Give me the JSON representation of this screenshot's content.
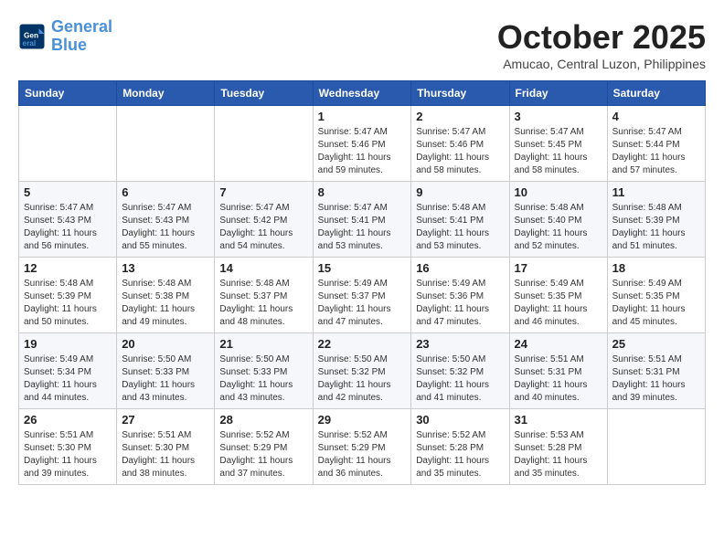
{
  "header": {
    "logo_line1": "General",
    "logo_line2": "Blue",
    "month": "October 2025",
    "location": "Amucao, Central Luzon, Philippines"
  },
  "weekdays": [
    "Sunday",
    "Monday",
    "Tuesday",
    "Wednesday",
    "Thursday",
    "Friday",
    "Saturday"
  ],
  "weeks": [
    [
      {
        "day": "",
        "sunrise": "",
        "sunset": "",
        "daylight": ""
      },
      {
        "day": "",
        "sunrise": "",
        "sunset": "",
        "daylight": ""
      },
      {
        "day": "",
        "sunrise": "",
        "sunset": "",
        "daylight": ""
      },
      {
        "day": "1",
        "sunrise": "Sunrise: 5:47 AM",
        "sunset": "Sunset: 5:46 PM",
        "daylight": "Daylight: 11 hours and 59 minutes."
      },
      {
        "day": "2",
        "sunrise": "Sunrise: 5:47 AM",
        "sunset": "Sunset: 5:46 PM",
        "daylight": "Daylight: 11 hours and 58 minutes."
      },
      {
        "day": "3",
        "sunrise": "Sunrise: 5:47 AM",
        "sunset": "Sunset: 5:45 PM",
        "daylight": "Daylight: 11 hours and 58 minutes."
      },
      {
        "day": "4",
        "sunrise": "Sunrise: 5:47 AM",
        "sunset": "Sunset: 5:44 PM",
        "daylight": "Daylight: 11 hours and 57 minutes."
      }
    ],
    [
      {
        "day": "5",
        "sunrise": "Sunrise: 5:47 AM",
        "sunset": "Sunset: 5:43 PM",
        "daylight": "Daylight: 11 hours and 56 minutes."
      },
      {
        "day": "6",
        "sunrise": "Sunrise: 5:47 AM",
        "sunset": "Sunset: 5:43 PM",
        "daylight": "Daylight: 11 hours and 55 minutes."
      },
      {
        "day": "7",
        "sunrise": "Sunrise: 5:47 AM",
        "sunset": "Sunset: 5:42 PM",
        "daylight": "Daylight: 11 hours and 54 minutes."
      },
      {
        "day": "8",
        "sunrise": "Sunrise: 5:47 AM",
        "sunset": "Sunset: 5:41 PM",
        "daylight": "Daylight: 11 hours and 53 minutes."
      },
      {
        "day": "9",
        "sunrise": "Sunrise: 5:48 AM",
        "sunset": "Sunset: 5:41 PM",
        "daylight": "Daylight: 11 hours and 53 minutes."
      },
      {
        "day": "10",
        "sunrise": "Sunrise: 5:48 AM",
        "sunset": "Sunset: 5:40 PM",
        "daylight": "Daylight: 11 hours and 52 minutes."
      },
      {
        "day": "11",
        "sunrise": "Sunrise: 5:48 AM",
        "sunset": "Sunset: 5:39 PM",
        "daylight": "Daylight: 11 hours and 51 minutes."
      }
    ],
    [
      {
        "day": "12",
        "sunrise": "Sunrise: 5:48 AM",
        "sunset": "Sunset: 5:39 PM",
        "daylight": "Daylight: 11 hours and 50 minutes."
      },
      {
        "day": "13",
        "sunrise": "Sunrise: 5:48 AM",
        "sunset": "Sunset: 5:38 PM",
        "daylight": "Daylight: 11 hours and 49 minutes."
      },
      {
        "day": "14",
        "sunrise": "Sunrise: 5:48 AM",
        "sunset": "Sunset: 5:37 PM",
        "daylight": "Daylight: 11 hours and 48 minutes."
      },
      {
        "day": "15",
        "sunrise": "Sunrise: 5:49 AM",
        "sunset": "Sunset: 5:37 PM",
        "daylight": "Daylight: 11 hours and 47 minutes."
      },
      {
        "day": "16",
        "sunrise": "Sunrise: 5:49 AM",
        "sunset": "Sunset: 5:36 PM",
        "daylight": "Daylight: 11 hours and 47 minutes."
      },
      {
        "day": "17",
        "sunrise": "Sunrise: 5:49 AM",
        "sunset": "Sunset: 5:35 PM",
        "daylight": "Daylight: 11 hours and 46 minutes."
      },
      {
        "day": "18",
        "sunrise": "Sunrise: 5:49 AM",
        "sunset": "Sunset: 5:35 PM",
        "daylight": "Daylight: 11 hours and 45 minutes."
      }
    ],
    [
      {
        "day": "19",
        "sunrise": "Sunrise: 5:49 AM",
        "sunset": "Sunset: 5:34 PM",
        "daylight": "Daylight: 11 hours and 44 minutes."
      },
      {
        "day": "20",
        "sunrise": "Sunrise: 5:50 AM",
        "sunset": "Sunset: 5:33 PM",
        "daylight": "Daylight: 11 hours and 43 minutes."
      },
      {
        "day": "21",
        "sunrise": "Sunrise: 5:50 AM",
        "sunset": "Sunset: 5:33 PM",
        "daylight": "Daylight: 11 hours and 43 minutes."
      },
      {
        "day": "22",
        "sunrise": "Sunrise: 5:50 AM",
        "sunset": "Sunset: 5:32 PM",
        "daylight": "Daylight: 11 hours and 42 minutes."
      },
      {
        "day": "23",
        "sunrise": "Sunrise: 5:50 AM",
        "sunset": "Sunset: 5:32 PM",
        "daylight": "Daylight: 11 hours and 41 minutes."
      },
      {
        "day": "24",
        "sunrise": "Sunrise: 5:51 AM",
        "sunset": "Sunset: 5:31 PM",
        "daylight": "Daylight: 11 hours and 40 minutes."
      },
      {
        "day": "25",
        "sunrise": "Sunrise: 5:51 AM",
        "sunset": "Sunset: 5:31 PM",
        "daylight": "Daylight: 11 hours and 39 minutes."
      }
    ],
    [
      {
        "day": "26",
        "sunrise": "Sunrise: 5:51 AM",
        "sunset": "Sunset: 5:30 PM",
        "daylight": "Daylight: 11 hours and 39 minutes."
      },
      {
        "day": "27",
        "sunrise": "Sunrise: 5:51 AM",
        "sunset": "Sunset: 5:30 PM",
        "daylight": "Daylight: 11 hours and 38 minutes."
      },
      {
        "day": "28",
        "sunrise": "Sunrise: 5:52 AM",
        "sunset": "Sunset: 5:29 PM",
        "daylight": "Daylight: 11 hours and 37 minutes."
      },
      {
        "day": "29",
        "sunrise": "Sunrise: 5:52 AM",
        "sunset": "Sunset: 5:29 PM",
        "daylight": "Daylight: 11 hours and 36 minutes."
      },
      {
        "day": "30",
        "sunrise": "Sunrise: 5:52 AM",
        "sunset": "Sunset: 5:28 PM",
        "daylight": "Daylight: 11 hours and 35 minutes."
      },
      {
        "day": "31",
        "sunrise": "Sunrise: 5:53 AM",
        "sunset": "Sunset: 5:28 PM",
        "daylight": "Daylight: 11 hours and 35 minutes."
      },
      {
        "day": "",
        "sunrise": "",
        "sunset": "",
        "daylight": ""
      }
    ]
  ]
}
